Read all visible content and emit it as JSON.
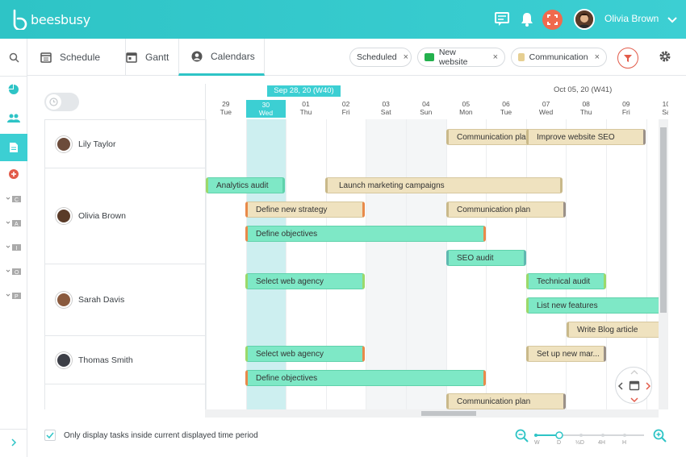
{
  "app": {
    "logo_text": "beesbusy",
    "user_name": "Olivia Brown"
  },
  "nav": {
    "tabs": [
      {
        "label": "Schedule"
      },
      {
        "label": "Gantt"
      },
      {
        "label": "Calendars"
      }
    ],
    "chips": [
      {
        "label": "Scheduled"
      },
      {
        "label": "New website"
      },
      {
        "label": "Communication"
      }
    ],
    "chip_close": "×"
  },
  "timeline": {
    "today_label": "Sep 28, 20 (W40)",
    "week2_label": "Oct 05, 20 (W41)",
    "days": [
      {
        "num": "29",
        "name": "Tue"
      },
      {
        "num": "30",
        "name": "Wed"
      },
      {
        "num": "01",
        "name": "Thu"
      },
      {
        "num": "02",
        "name": "Fri"
      },
      {
        "num": "03",
        "name": "Sat"
      },
      {
        "num": "04",
        "name": "Sun"
      },
      {
        "num": "05",
        "name": "Mon"
      },
      {
        "num": "06",
        "name": "Tue"
      },
      {
        "num": "07",
        "name": "Wed"
      },
      {
        "num": "08",
        "name": "Thu"
      },
      {
        "num": "09",
        "name": "Fri"
      },
      {
        "num": "10",
        "name": "Sa"
      }
    ]
  },
  "people": [
    {
      "name": "Lily Taylor"
    },
    {
      "name": "Olivia Brown"
    },
    {
      "name": "Sarah Davis"
    },
    {
      "name": "Thomas Smith"
    }
  ],
  "tasks": [
    {
      "label": "Communication plan"
    },
    {
      "label": "Improve website SEO"
    },
    {
      "label": "Analytics audit"
    },
    {
      "label": "Launch marketing campaigns"
    },
    {
      "label": "Define new strategy"
    },
    {
      "label": "Communication plan"
    },
    {
      "label": "Define objectives"
    },
    {
      "label": "SEO audit"
    },
    {
      "label": "Select web agency"
    },
    {
      "label": "Technical audit"
    },
    {
      "label": "List new features"
    },
    {
      "label": "Write Blog article"
    },
    {
      "label": "Select web agency"
    },
    {
      "label": "Set up new mar..."
    },
    {
      "label": "Define objectives"
    },
    {
      "label": "Communication plan"
    }
  ],
  "footer": {
    "checkbox_label": "Only display tasks inside current displayed time period",
    "zoom_levels": [
      "W",
      "D",
      "½D",
      "4H",
      "H"
    ]
  },
  "colors": {
    "accent": "#3ccfd3",
    "danger": "#e25b4a",
    "beige": "#efe2bf",
    "green": "#7ee8c6"
  }
}
